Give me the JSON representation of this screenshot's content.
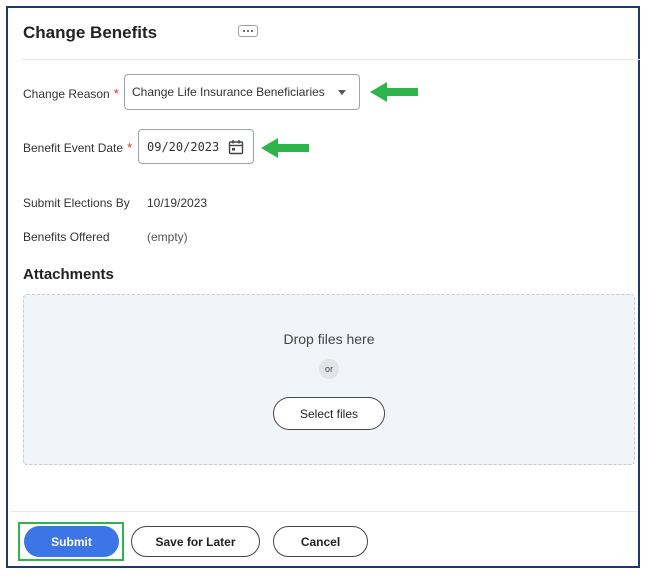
{
  "header": {
    "title": "Change Benefits",
    "more_icon": "more-options-icon"
  },
  "form": {
    "change_reason": {
      "label": "Change Reason",
      "required_mark": "*",
      "value": "Change Life Insurance Beneficiaries",
      "icon": "dropdown-caret-icon"
    },
    "benefit_event_date": {
      "label": "Benefit Event Date",
      "required_mark": "*",
      "value": "09/20/2023",
      "icon": "calendar-icon"
    },
    "submit_elections_by": {
      "label": "Submit Elections By",
      "value": "10/19/2023"
    },
    "benefits_offered": {
      "label": "Benefits Offered",
      "value": "(empty)"
    }
  },
  "attachments": {
    "title": "Attachments",
    "drop_text": "Drop files here",
    "or_text": "or",
    "select_button": "Select files"
  },
  "footer": {
    "submit_label": "Submit",
    "save_label": "Save for Later",
    "cancel_label": "Cancel"
  },
  "colors": {
    "primary": "#3b75e6",
    "required": "#d9302c",
    "annotation_green": "#2db54b",
    "frame": "#1c3a6e"
  }
}
